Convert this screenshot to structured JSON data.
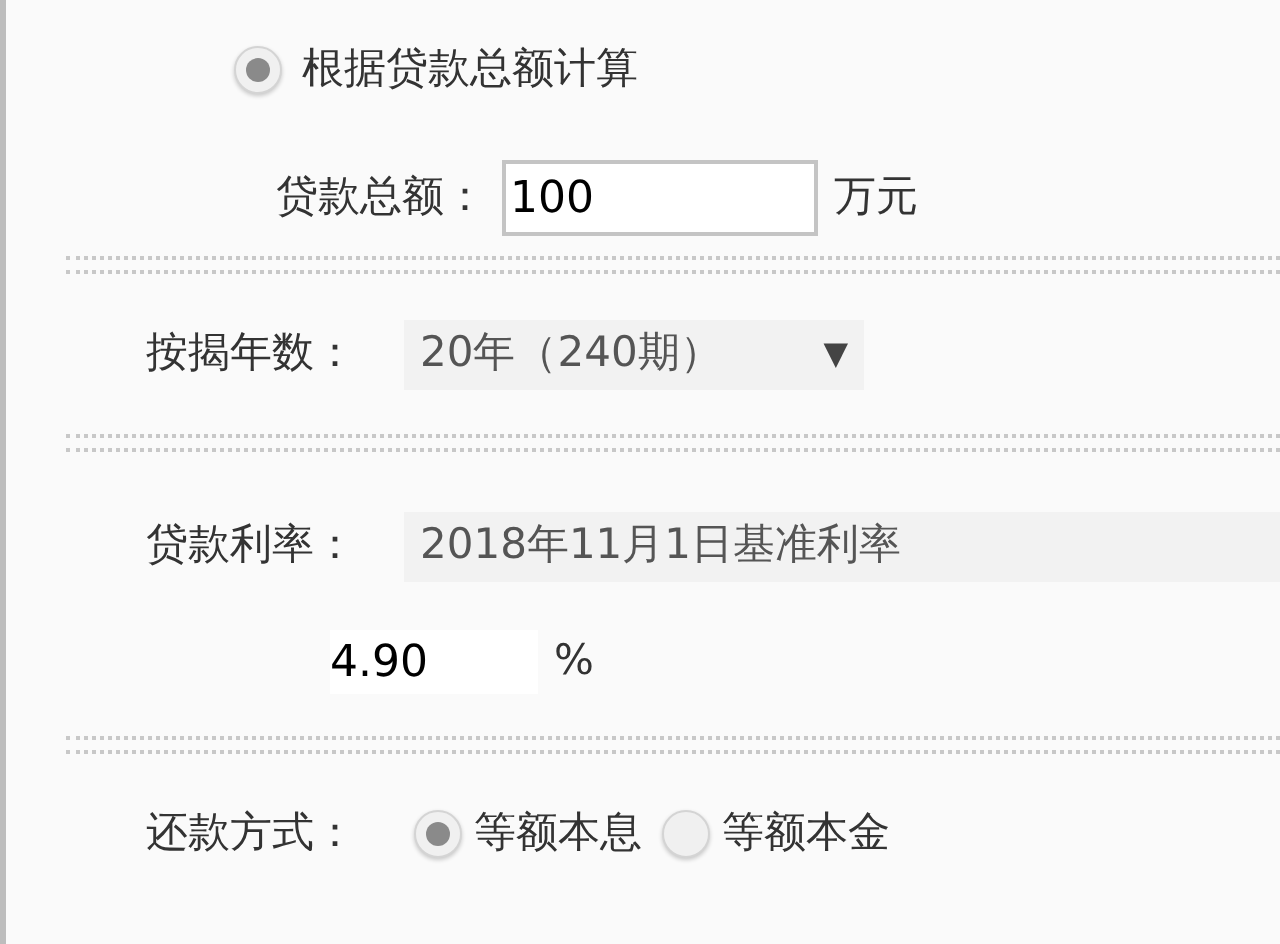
{
  "calc_mode": {
    "label": "根据贷款总额计算",
    "selected": true
  },
  "loan_amount": {
    "label": "贷款总额：",
    "value": "100",
    "unit": "万元"
  },
  "term": {
    "label": "按揭年数：",
    "value": "20年（240期）",
    "arrow": "▼"
  },
  "rate": {
    "label": "贷款利率：",
    "value": "2018年11月1日基准利率",
    "percent": "4.90",
    "unit": "%"
  },
  "repayment": {
    "label": "还款方式：",
    "options": [
      {
        "label": "等额本息",
        "selected": true
      },
      {
        "label": "等额本金",
        "selected": false
      }
    ]
  }
}
